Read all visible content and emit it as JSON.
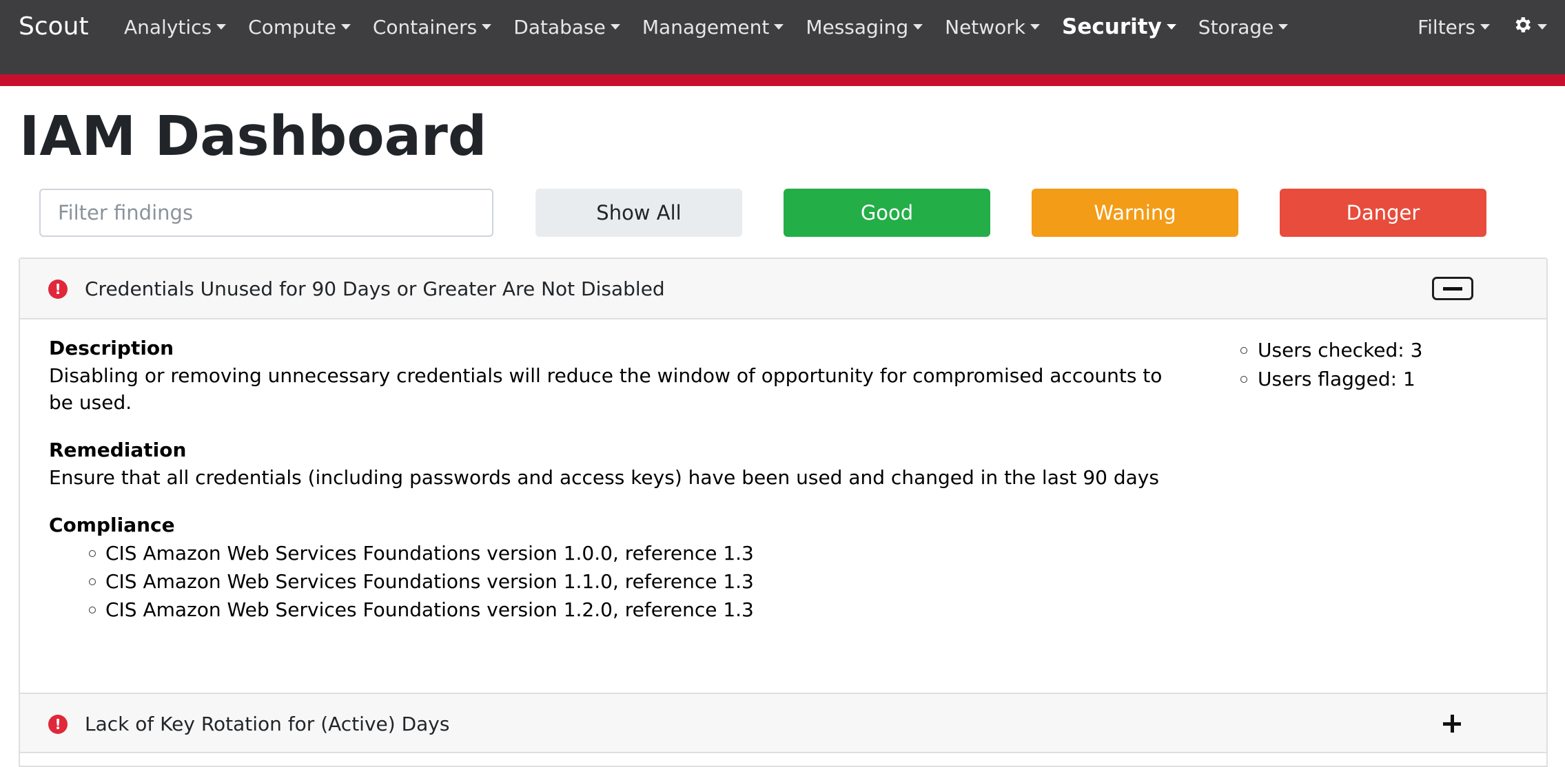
{
  "navbar": {
    "brand": "Scout",
    "menus": [
      {
        "label": "Analytics"
      },
      {
        "label": "Compute"
      },
      {
        "label": "Containers"
      },
      {
        "label": "Database"
      },
      {
        "label": "Management"
      },
      {
        "label": "Messaging"
      },
      {
        "label": "Network"
      },
      {
        "label": "Security",
        "active": true
      },
      {
        "label": "Storage"
      }
    ],
    "filters_label": "Filters",
    "settings_icon": "gear-icon",
    "accent_color": "#c8102e"
  },
  "page": {
    "title": "IAM Dashboard"
  },
  "filter_bar": {
    "placeholder": "Filter findings",
    "value": "",
    "buttons": {
      "show_all": "Show All",
      "good": "Good",
      "warning": "Warning",
      "danger": "Danger"
    },
    "colors": {
      "good": "#23ae48",
      "warning": "#f39c17",
      "danger": "#e74c3c"
    }
  },
  "findings": [
    {
      "level": "danger",
      "icon": "exclamation-circle-icon",
      "title": "Credentials Unused for 90 Days or Greater Are Not Disabled",
      "expanded": true,
      "description_label": "Description",
      "description": "Disabling or removing unnecessary credentials will reduce the window of opportunity for compromised accounts to be used.",
      "remediation_label": "Remediation",
      "remediation": "Ensure that all credentials (including passwords and access keys) have been used and changed in the last 90 days",
      "compliance_label": "Compliance",
      "compliance": [
        "CIS Amazon Web Services Foundations version 1.0.0, reference 1.3",
        "CIS Amazon Web Services Foundations version 1.1.0, reference 1.3",
        "CIS Amazon Web Services Foundations version 1.2.0, reference 1.3"
      ],
      "stats": [
        "Users checked: 3",
        "Users flagged: 1"
      ]
    },
    {
      "level": "danger",
      "icon": "exclamation-circle-icon",
      "title": "Lack of Key Rotation for (Active) Days",
      "expanded": false
    }
  ]
}
